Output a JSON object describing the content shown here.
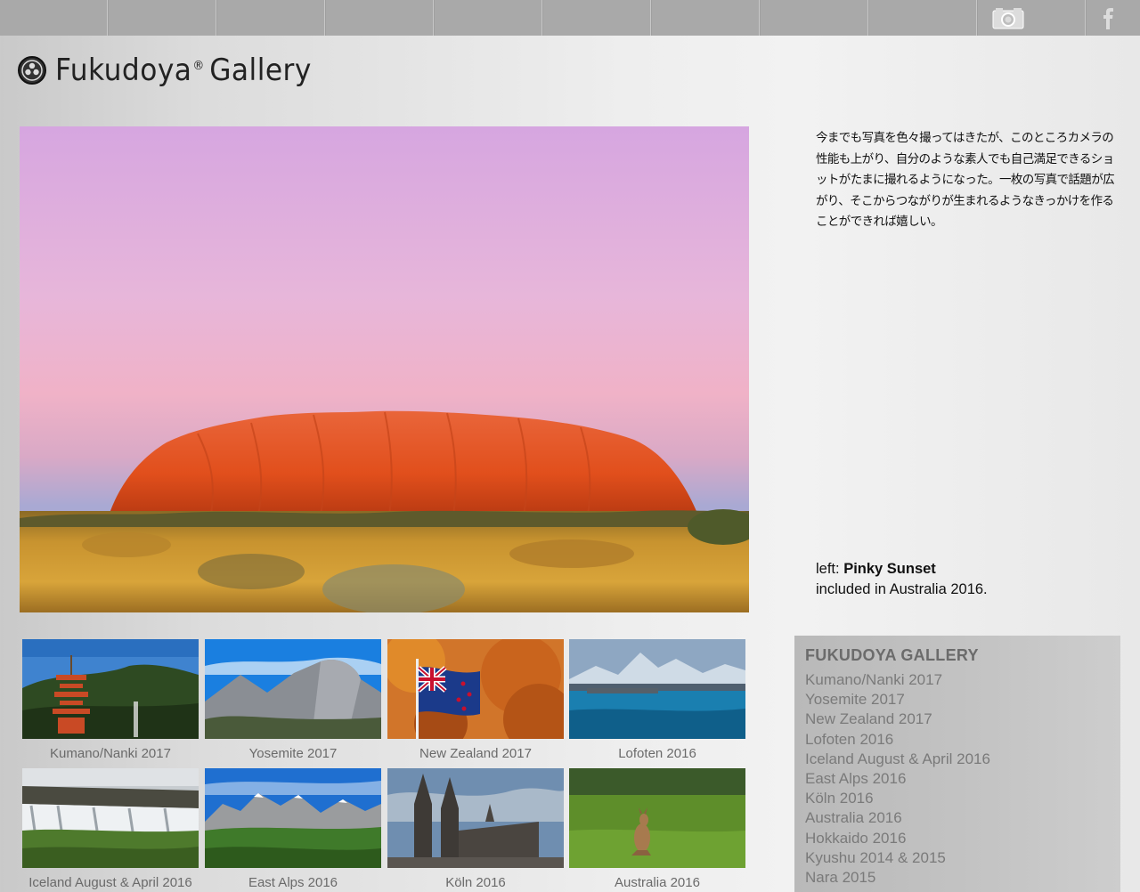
{
  "topbar": {
    "camera_icon": "camera-icon",
    "facebook_icon": "facebook-icon"
  },
  "logo": {
    "name": "Fukudoya",
    "registered": "®",
    "suffix": "Gallery"
  },
  "intro_text": "今までも写真を色々撮ってはきたが、このところカメラの性能も上がり、自分のような素人でも自己満足できるショットがたまに撮れるようになった。一枚の写真で話題が広がり、そこからつながりが生まれるようなきっかけを作ることができれば嬉しい。",
  "caption": {
    "prefix": "left: ",
    "title": "Pinky Sunset",
    "line2": "included in Australia 2016."
  },
  "thumbnails": [
    {
      "label": "Kumano/Nanki 2017"
    },
    {
      "label": "Yosemite 2017"
    },
    {
      "label": "New Zealand 2017"
    },
    {
      "label": "Lofoten 2016"
    },
    {
      "label": "Iceland August & April 2016"
    },
    {
      "label": "East Alps 2016"
    },
    {
      "label": "Köln 2016"
    },
    {
      "label": "Australia 2016"
    }
  ],
  "side_nav": {
    "heading": "FUKUDOYA GALLERY",
    "items": [
      "Kumano/Nanki 2017",
      "Yosemite 2017",
      "New Zealand 2017",
      "Lofoten 2016",
      "Iceland August & April 2016",
      "East Alps 2016",
      "Köln 2016",
      "Australia 2016",
      "Hokkaido 2016",
      "Kyushu 2014 & 2015",
      "Nara 2015"
    ]
  }
}
